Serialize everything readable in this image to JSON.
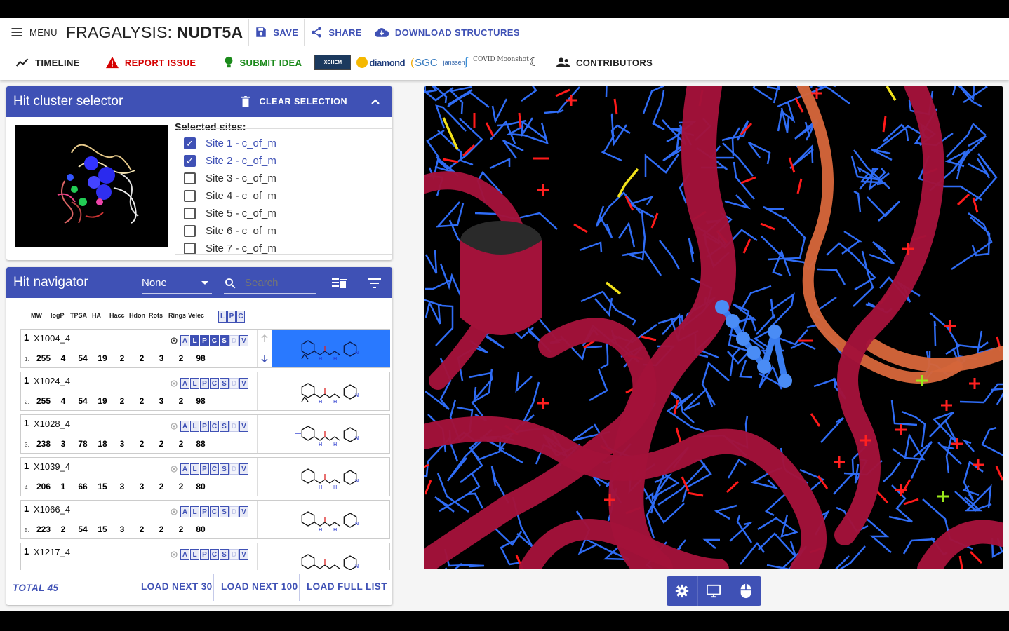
{
  "header": {
    "menu_label": "MENU",
    "title_prefix": "FRAGALYSIS:",
    "title_target": "NUDT5A",
    "save_label": "SAVE",
    "share_label": "SHARE",
    "download_label": "DOWNLOAD STRUCTURES",
    "timeline_label": "TIMELINE",
    "report_label": "REPORT ISSUE",
    "idea_label": "SUBMIT IDEA",
    "contributors_label": "CONTRIBUTORS",
    "logos": [
      "XCHEM",
      "diamond",
      "SGC",
      "janssen",
      "COVID Moonshot"
    ]
  },
  "cluster": {
    "title": "Hit cluster selector",
    "clear_label": "CLEAR SELECTION",
    "selected_label": "Selected sites:",
    "sites": [
      {
        "label": "Site 1 - c_of_m",
        "checked": true
      },
      {
        "label": "Site 2 - c_of_m",
        "checked": true
      },
      {
        "label": "Site 3 - c_of_m",
        "checked": false
      },
      {
        "label": "Site 4 - c_of_m",
        "checked": false
      },
      {
        "label": "Site 5 - c_of_m",
        "checked": false
      },
      {
        "label": "Site 6 - c_of_m",
        "checked": false
      },
      {
        "label": "Site 7 - c_of_m",
        "checked": false
      }
    ]
  },
  "navigator": {
    "title": "Hit navigator",
    "filter_value": "None",
    "search_placeholder": "Search",
    "columns": [
      "MW",
      "logP",
      "TPSA",
      "HA",
      "Hacc",
      "Hdon",
      "Rots",
      "Rings",
      "Velec"
    ],
    "lpc": [
      "L",
      "P",
      "C"
    ],
    "hits": [
      {
        "rank": "1",
        "code": "X1004_4",
        "idx": "1.",
        "props": [
          "255",
          "4",
          "54",
          "19",
          "2",
          "2",
          "3",
          "2",
          "98"
        ],
        "selected": true
      },
      {
        "rank": "1",
        "code": "X1024_4",
        "idx": "2.",
        "props": [
          "255",
          "4",
          "54",
          "19",
          "2",
          "2",
          "3",
          "2",
          "98"
        ],
        "selected": false
      },
      {
        "rank": "1",
        "code": "X1028_4",
        "idx": "3.",
        "props": [
          "238",
          "3",
          "78",
          "18",
          "3",
          "2",
          "2",
          "2",
          "88"
        ],
        "selected": false
      },
      {
        "rank": "1",
        "code": "X1039_4",
        "idx": "4.",
        "props": [
          "206",
          "1",
          "66",
          "15",
          "3",
          "3",
          "2",
          "2",
          "80"
        ],
        "selected": false
      },
      {
        "rank": "1",
        "code": "X1066_4",
        "idx": "5.",
        "props": [
          "223",
          "2",
          "54",
          "15",
          "3",
          "2",
          "2",
          "2",
          "80"
        ],
        "selected": false
      },
      {
        "rank": "1",
        "code": "X1217_4",
        "idx": "6.",
        "props": [
          "",
          "",
          "",
          "",
          "",
          "",
          "",
          "",
          ""
        ],
        "selected": false
      }
    ],
    "toggle_letters": [
      "A",
      "L",
      "P",
      "C",
      "S",
      "D",
      "V"
    ],
    "total_label": "TOTAL 45",
    "load30_label": "LOAD NEXT 30",
    "load100_label": "LOAD NEXT 100",
    "loadall_label": "LOAD FULL LIST"
  },
  "colors": {
    "primary": "#3f51b5",
    "selected_hit": "#2979ff",
    "ribbon": "#a3123a",
    "ribbon_orange": "#d4653a",
    "stick_blue": "#2f6cf5",
    "oxygen": "#ff1a1a"
  }
}
